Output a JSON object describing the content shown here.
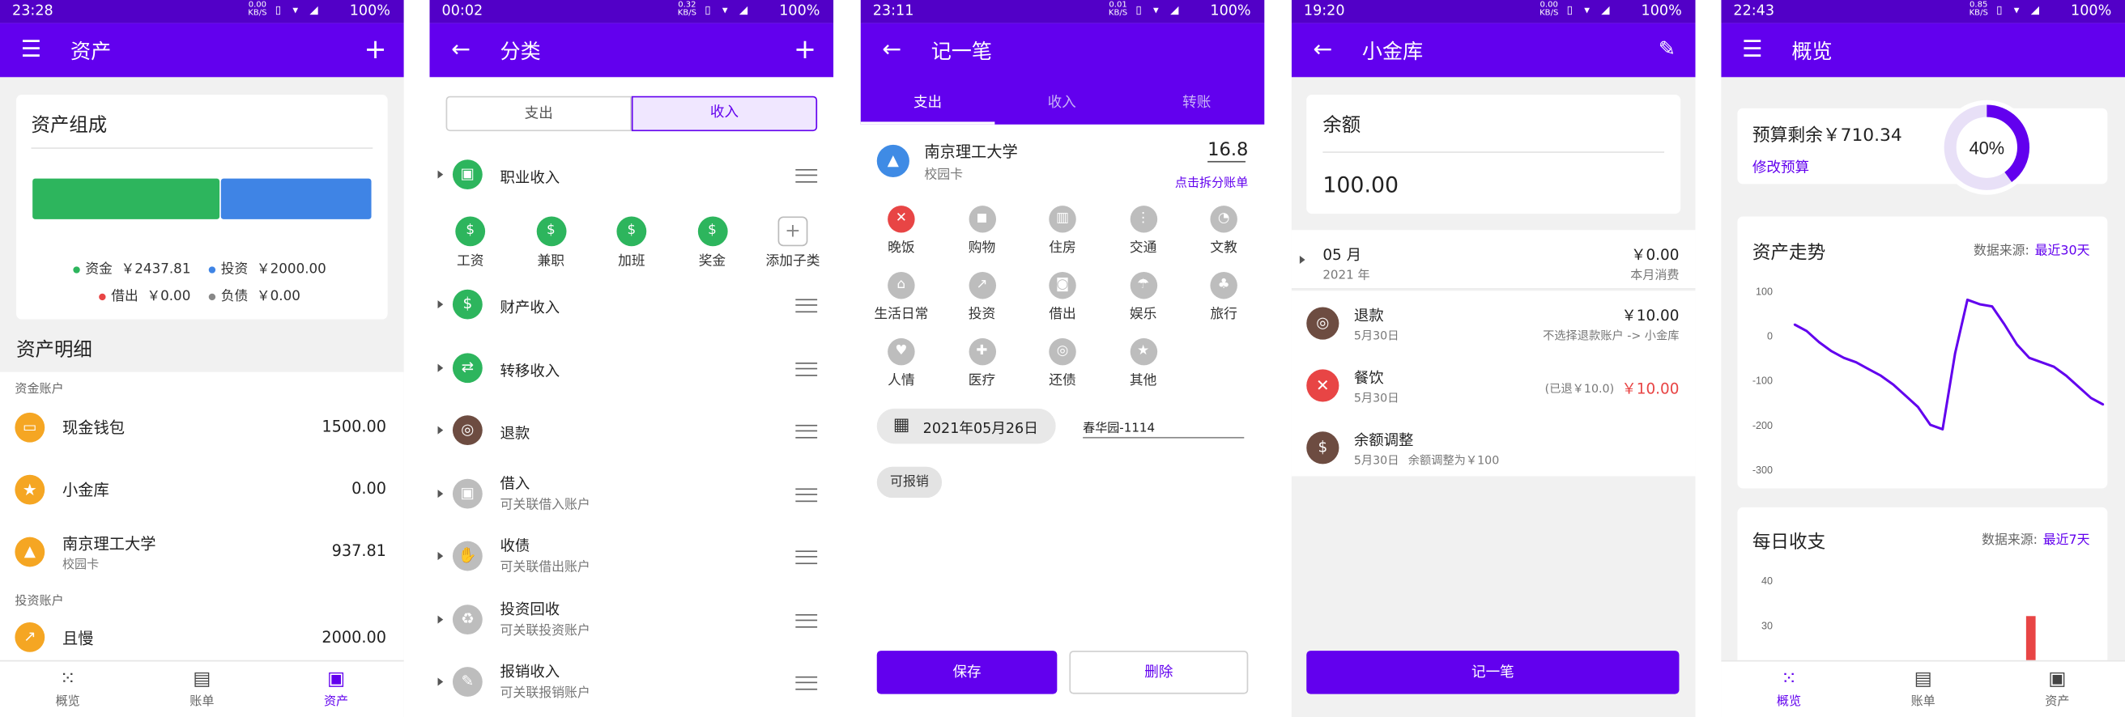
{
  "status": {
    "p1": {
      "time": "23:28",
      "net_top": "0.00",
      "net_unit": "KB/S",
      "battery": "100%"
    },
    "p2": {
      "time": "00:02",
      "net_top": "0.32",
      "net_unit": "KB/S",
      "battery": "100%"
    },
    "p3": {
      "time": "23:11",
      "net_top": "0.01",
      "net_unit": "KB/S",
      "battery": "100%"
    },
    "p4": {
      "time": "19:20",
      "net_top": "0.00",
      "net_unit": "KB/S",
      "battery": "100%"
    },
    "p5": {
      "time": "22:43",
      "net_top": "0.85",
      "net_unit": "KB/S",
      "battery": "100%"
    }
  },
  "assets": {
    "title": "资产",
    "add": "+",
    "comp_title": "资产组成",
    "bar": {
      "fund": 0.55,
      "invest": 0.45,
      "fund_color": "#2db55d",
      "invest_color": "#3f84e5"
    },
    "legend": [
      {
        "label": "资金",
        "value": "￥2437.81",
        "color": "#2db55d"
      },
      {
        "label": "投资",
        "value": "￥2000.00",
        "color": "#3f84e5"
      },
      {
        "label": "借出",
        "value": "￥0.00",
        "color": "#e84545"
      },
      {
        "label": "负债",
        "value": "￥0.00",
        "color": "#888888"
      }
    ],
    "detail_title": "资产明细",
    "group1": "资金账户",
    "group2": "投资账户",
    "accounts": [
      {
        "name": "现金钱包",
        "sub": "",
        "amount": "1500.00",
        "icon": "wallet-icon"
      },
      {
        "name": "小金库",
        "sub": "",
        "amount": "0.00",
        "icon": "star-icon"
      },
      {
        "name": "南京理工大学",
        "sub": "校园卡",
        "amount": "937.81",
        "icon": "graduation-cap-icon"
      }
    ],
    "invest": [
      {
        "name": "且慢",
        "amount": "2000.00",
        "icon": "trending-up-icon"
      }
    ]
  },
  "categories": {
    "title": "分类",
    "add": "+",
    "seg": [
      "支出",
      "收入"
    ],
    "groups": [
      {
        "name": "职业收入",
        "sub": "",
        "icon": "briefcase-icon",
        "active": true
      },
      {
        "name": "财产收入",
        "sub": "",
        "icon": "coins-icon",
        "active": true
      },
      {
        "name": "转移收入",
        "sub": "",
        "icon": "transfer-icon",
        "active": true
      },
      {
        "name": "退款",
        "sub": "",
        "icon": "refund-icon",
        "active": true
      },
      {
        "name": "借入",
        "sub": "可关联借入账户",
        "icon": "borrow-icon",
        "active": false
      },
      {
        "name": "收债",
        "sub": "可关联借出账户",
        "icon": "collect-debt-icon",
        "active": false
      },
      {
        "name": "投资回收",
        "sub": "可关联投资账户",
        "icon": "recycle-icon",
        "active": false
      },
      {
        "name": "报销收入",
        "sub": "可关联报销账户",
        "icon": "reimburse-icon",
        "active": false
      }
    ],
    "children": [
      {
        "name": "工资",
        "icon": "money-bag-icon"
      },
      {
        "name": "兼职",
        "icon": "money-bag-icon"
      },
      {
        "name": "加班",
        "icon": "money-bag-icon"
      },
      {
        "name": "奖金",
        "icon": "money-bag-icon"
      },
      {
        "name": "添加子类",
        "icon": "plus-icon"
      }
    ]
  },
  "record": {
    "title": "记一笔",
    "tabs": [
      "支出",
      "收入",
      "转账"
    ],
    "account_name": "南京理工大学",
    "account_sub": "校园卡",
    "amount": "16.8",
    "split": "点击拆分账单",
    "cats": [
      {
        "name": "晚饭",
        "icon": "utensils-icon",
        "sel": true
      },
      {
        "name": "购物",
        "icon": "bag-icon"
      },
      {
        "name": "住房",
        "icon": "building-icon"
      },
      {
        "name": "交通",
        "icon": "traffic-light-icon"
      },
      {
        "name": "文教",
        "icon": "book-icon"
      },
      {
        "name": "生活日常",
        "icon": "home-icon"
      },
      {
        "name": "投资",
        "icon": "chart-icon"
      },
      {
        "name": "借出",
        "icon": "lend-icon"
      },
      {
        "name": "娱乐",
        "icon": "umbrella-icon"
      },
      {
        "name": "旅行",
        "icon": "palm-tree-icon"
      },
      {
        "name": "人情",
        "icon": "heart-icon"
      },
      {
        "name": "医疗",
        "icon": "medical-icon"
      },
      {
        "name": "还债",
        "icon": "repay-icon"
      },
      {
        "name": "其他",
        "icon": "other-icon"
      }
    ],
    "date": "2021年05月26日",
    "note": "春华园-1114",
    "chip": "可报销",
    "save": "保存",
    "delete": "删除"
  },
  "vault": {
    "title": "小金库",
    "balance_label": "余额",
    "balance": "100.00",
    "month": "05 月",
    "year": "2021 年",
    "month_amount": "￥0.00",
    "month_label": "本月消费",
    "items": [
      {
        "name": "退款",
        "date": "5月30日",
        "desc": "",
        "right_top": "￥10.00",
        "right_bottom": "不选择退款账户 -> 小金库",
        "icon": "refund-icon",
        "color": "#6d4c41"
      },
      {
        "name": "餐饮",
        "date": "5月30日",
        "desc": "",
        "prefix": "(已退￥10.0)",
        "right_top": "￥10.00",
        "right_bottom": "",
        "icon": "utensils-icon",
        "color": "#e84545"
      },
      {
        "name": "余额调整",
        "date": "5月30日",
        "desc": "余额调整为￥100",
        "right_top": "",
        "right_bottom": "",
        "icon": "money-bag-icon",
        "color": "#6d4c41"
      }
    ],
    "button": "记一笔"
  },
  "overview": {
    "title": "概览",
    "budget_label": "预算剩余￥710.34",
    "budget_link": "修改预算",
    "budget_pct": "40%",
    "budget_fraction": 0.4,
    "trend_title": "资产走势",
    "trend_source_label": "数据来源:",
    "trend_source": "最近30天",
    "daily_title": "每日收支",
    "daily_source_label": "数据来源:",
    "daily_source": "最近7天"
  },
  "chart_data": [
    {
      "type": "line",
      "title": "资产走势",
      "yticks": [
        "100",
        "0",
        "-100",
        "-200",
        "-300"
      ],
      "ylim": [
        -300,
        100
      ],
      "y": [
        25,
        10,
        -15,
        -35,
        -50,
        -60,
        -75,
        -90,
        -110,
        -135,
        -160,
        -200,
        -210,
        -40,
        80,
        70,
        65,
        25,
        -20,
        -50,
        -60,
        -70,
        -90,
        -115,
        -140,
        -155
      ],
      "series": [
        {
          "name": "",
          "values": [
            25,
            10,
            -15,
            -35,
            -50,
            -60,
            -75,
            -90,
            -110,
            -135,
            -160,
            -200,
            -210,
            -40,
            80,
            70,
            65,
            25,
            -20,
            -50,
            -60,
            -70,
            -90,
            -115,
            -140,
            -155
          ]
        }
      ]
    },
    {
      "type": "bar",
      "title": "每日收支",
      "yticks": [
        "40",
        "30"
      ],
      "ylim": [
        20,
        40
      ],
      "values": [
        0,
        0,
        0,
        0,
        0,
        32,
        0
      ]
    }
  ],
  "nav": {
    "overview": "概览",
    "bills": "账单",
    "assets": "资产"
  }
}
